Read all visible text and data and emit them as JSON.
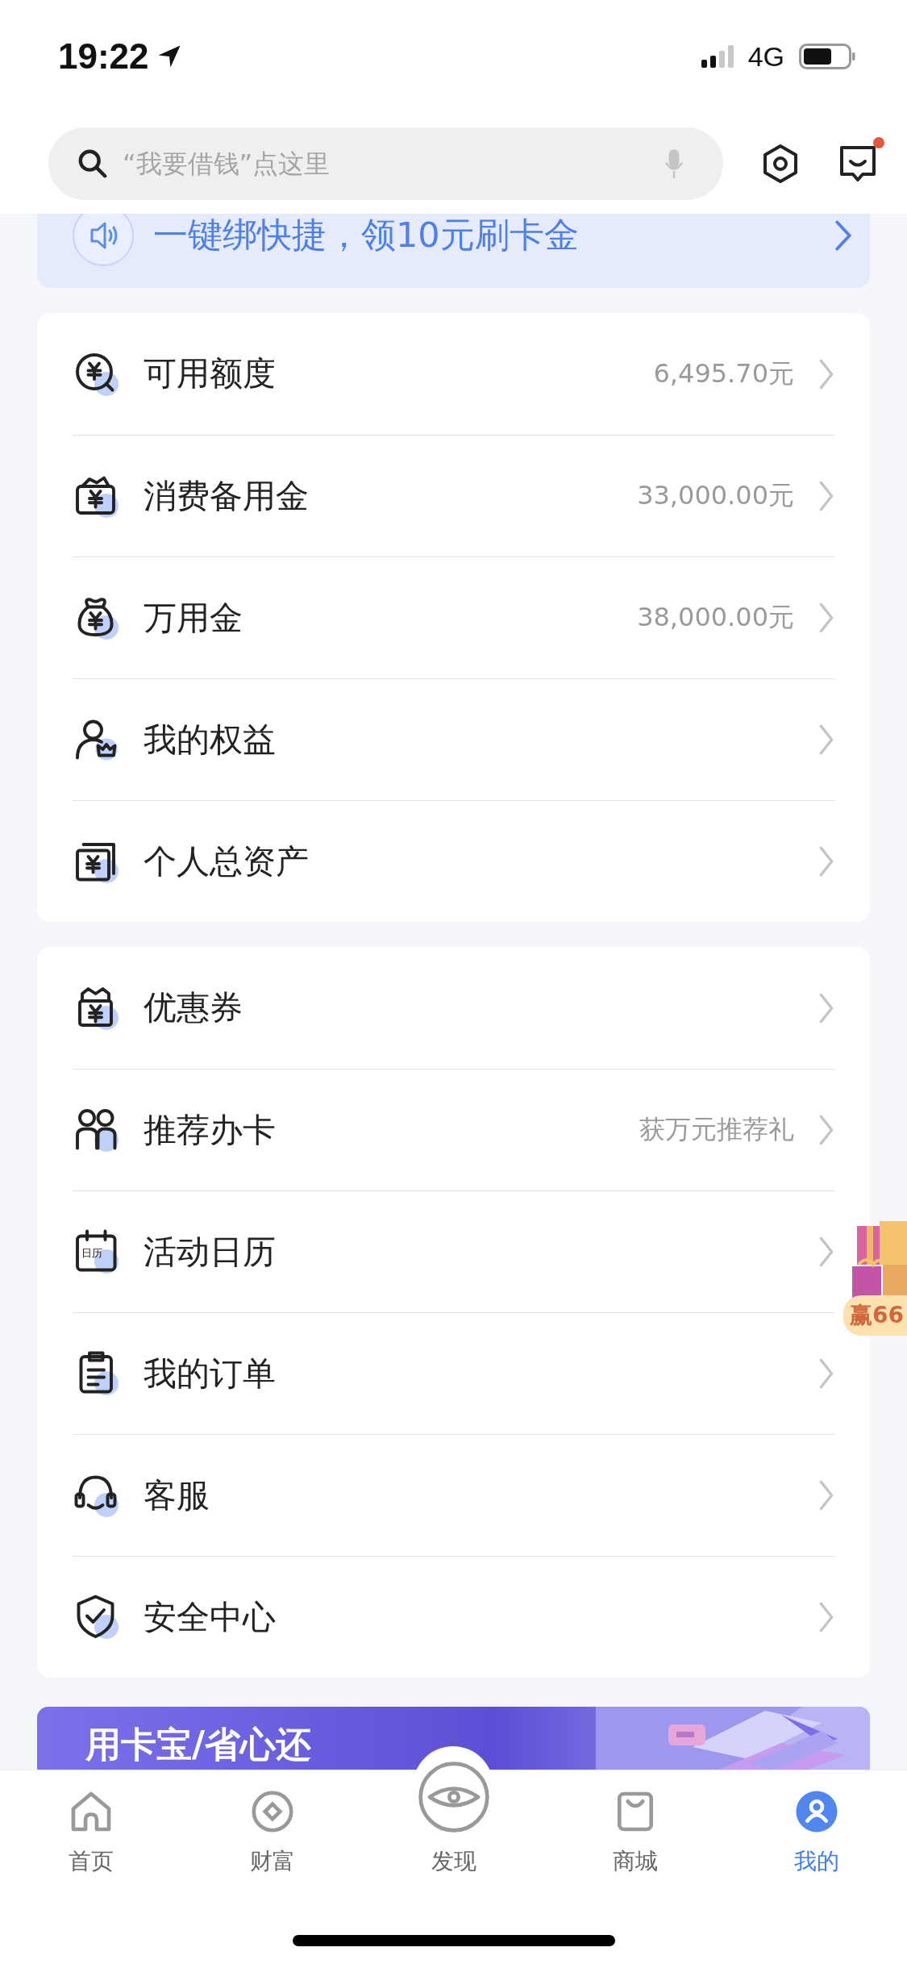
{
  "status_bar": {
    "time": "19:22",
    "network": "4G"
  },
  "search": {
    "placeholder": "“我要借钱”点这里"
  },
  "header": {
    "has_notification": true
  },
  "promo": {
    "text": "一键绑快捷，领10元刷卡金"
  },
  "sections": [
    {
      "items": [
        {
          "label": "可用额度",
          "value": "6,495.70元"
        },
        {
          "label": "消费备用金",
          "value": "33,000.00元"
        },
        {
          "label": "万用金",
          "value": "38,000.00元"
        },
        {
          "label": "我的权益"
        },
        {
          "label": "个人总资产"
        }
      ]
    },
    {
      "items": [
        {
          "label": "优惠券"
        },
        {
          "label": "推荐办卡",
          "value": "获万元推荐礼"
        },
        {
          "label": "活动日历",
          "icon_label": "日历"
        },
        {
          "label": "我的订单"
        },
        {
          "label": "客服"
        },
        {
          "label": "安全中心"
        }
      ]
    }
  ],
  "floating_badge": {
    "text": "赢66"
  },
  "banner": {
    "text": "用卡宝/省心还"
  },
  "tabs": [
    {
      "label": "首页",
      "selected": false
    },
    {
      "label": "财富",
      "selected": false
    },
    {
      "label": "发现",
      "selected": false
    },
    {
      "label": "商城",
      "selected": false
    },
    {
      "label": "我的",
      "selected": true
    }
  ]
}
